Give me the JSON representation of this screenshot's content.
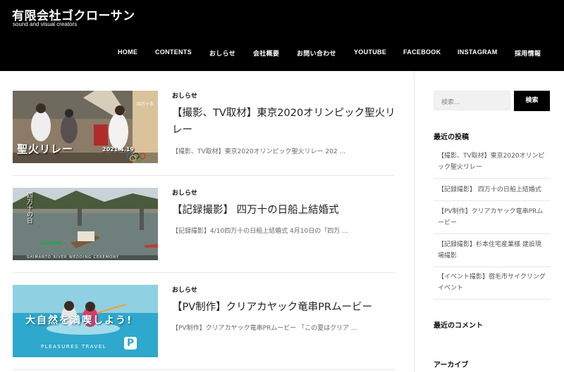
{
  "site": {
    "title": "有限会社ゴクローサン",
    "tagline": "sound and visual creators"
  },
  "nav": [
    "HOME",
    "CONTENTS",
    "おしらせ",
    "会社概要",
    "お問い合わせ",
    "YOUTUBE",
    "FACEBOOK",
    "INSTAGRAM",
    "採用情報"
  ],
  "posts": [
    {
      "category": "おしらせ",
      "title_line1": "【撮影、TV取材】東京2020オリンピック聖火リ",
      "title_line2": "レー",
      "excerpt": "【撮影、TV取材】東京2020オリンピック聖火リレー 202 ...",
      "thumb": {
        "caption": "聖火リレー",
        "badge_line1": "四万十市",
        "date": "2021.4.19"
      }
    },
    {
      "category": "おしらせ",
      "title_line1": "【記録撮影】 四万十の日船上結婚式",
      "title_line2": "",
      "excerpt": "【記録撮影】4/10四万十の日船上結婚式 4月10日の「四万 ...",
      "thumb": {
        "caption": "四万十の日",
        "subcaption": "SHIMANTO RIVER WEDDING CEREMONY"
      }
    },
    {
      "category": "おしらせ",
      "title_line1": "【PV制作】クリアカヤック竜串PRムービー",
      "title_line2": "",
      "excerpt": "【PV制作】クリアカヤック竜串PRムービー 「この夏はクリア ...",
      "thumb": {
        "caption": "大自然を満喫しよう!",
        "subcaption": "PLEASURES TRAVEL"
      }
    }
  ],
  "sidebar": {
    "search_placeholder": "検索...",
    "search_button": "検索",
    "recent_posts_title": "最近の投稿",
    "recent_posts": [
      [
        "【撮影、TV取材】東京2020オリンピ",
        "ック聖火リレー"
      ],
      [
        "【記録撮影】 四万十の日船上結婚式"
      ],
      [
        "【PV制作】クリアカヤック竜串PRム",
        "ービー"
      ],
      [
        "【記録撮影】杉本住宅産業様 建設現",
        "場撮影"
      ],
      [
        "【イベント撮影】宿毛市サイクリング",
        "イベント"
      ]
    ],
    "recent_comments_title": "最近のコメント",
    "archive_title": "アーカイブ"
  },
  "colors": {
    "header_bg": "#000000",
    "text": "#222222",
    "muted": "#666666"
  }
}
